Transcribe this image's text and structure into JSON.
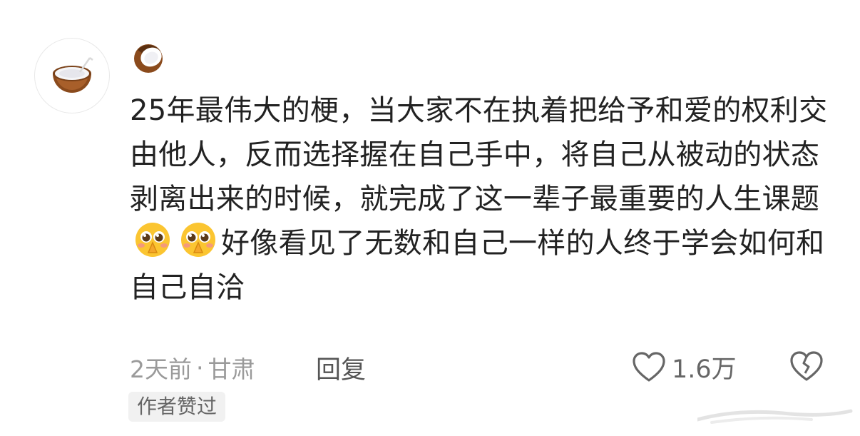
{
  "comment": {
    "username_icon": "coconut-icon",
    "avatar_icon": "coconut-icon",
    "text_before_emoji": "25年最伟大的梗，当大家不在执着把给予和爱的权利交由他人，反而选择握在自己手中，将自己从被动的状态剥离出来的时候，就完成了这一辈子最重要的人生课题",
    "emojis": [
      "pleading-hands-emoji",
      "pleading-hands-emoji"
    ],
    "text_after_emoji": "好像看见了无数和自己一样的人终于学会如何和自己自洽",
    "time": "2天前",
    "separator": "·",
    "location": "甘肃",
    "reply_label": "回复",
    "likes": "1.6万",
    "badge": "作者赞过"
  },
  "colors": {
    "text": "#222222",
    "meta": "#9a9a9a",
    "badge_bg": "#f1f1f1"
  }
}
